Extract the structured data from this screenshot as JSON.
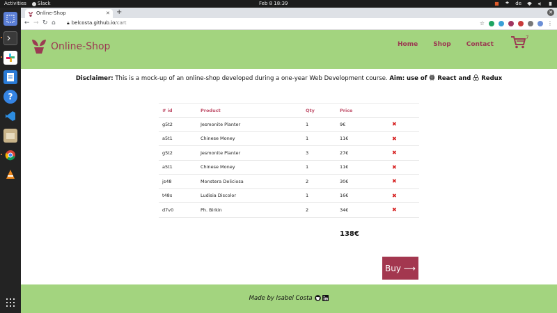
{
  "system": {
    "activities": "Activities",
    "app": "Slack",
    "clock": "Feb 8  18:39",
    "lang": "de"
  },
  "browser": {
    "tab_title": "Online-Shop",
    "url_host": "belcosta.github.io",
    "url_path": "/cart"
  },
  "site": {
    "brand": "Online-Shop",
    "nav": [
      "Home",
      "Shop",
      "Contact"
    ],
    "cart_count": "7",
    "disclaimer_label": "Disclaimer:",
    "disclaimer_text": " This is a mock-up of an online-shop developed during a one-year Web Development course. ",
    "aim_label": "Aim: use of ",
    "react": " React",
    "and": " and ",
    "redux": " Redux",
    "table": {
      "headers": [
        "# id",
        "Product",
        "Qty",
        "Price"
      ],
      "rows": [
        {
          "id": "g5t2",
          "product": "Jesmonite Planter",
          "qty": "1",
          "price": "9€"
        },
        {
          "id": "a5t1",
          "product": "Chinese Money",
          "qty": "1",
          "price": "11€"
        },
        {
          "id": "g5t2",
          "product": "Jesmonite Planter",
          "qty": "3",
          "price": "27€"
        },
        {
          "id": "a5t1",
          "product": "Chinese Money",
          "qty": "1",
          "price": "11€"
        },
        {
          "id": "js48",
          "product": "Monstera Deliciosa",
          "qty": "2",
          "price": "30€"
        },
        {
          "id": "t48s",
          "product": "Ludisia Discolor",
          "qty": "1",
          "price": "16€"
        },
        {
          "id": "d7v0",
          "product": "Ph. Birkin",
          "qty": "2",
          "price": "34€"
        }
      ],
      "delete_glyph": "✖"
    },
    "total": "138€",
    "buy_label": "Buy ⟶",
    "footer": "Made by Isabel Costa"
  }
}
